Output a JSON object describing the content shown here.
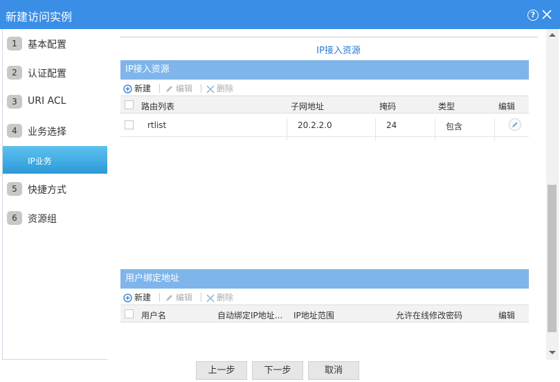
{
  "dialog": {
    "title": "新建访问实例",
    "help_glyph": "?"
  },
  "sidebar": {
    "steps": [
      {
        "num": "1",
        "label": "基本配置"
      },
      {
        "num": "2",
        "label": "认证配置"
      },
      {
        "num": "3",
        "label": "URI ACL"
      },
      {
        "num": "4",
        "label": "业务选择"
      },
      {
        "num": "5",
        "label": "快捷方式"
      },
      {
        "num": "6",
        "label": "资源组"
      }
    ],
    "active_sub": "IP业务"
  },
  "section": {
    "title": "IP接入资源"
  },
  "ip_panel": {
    "title": "IP接入资源",
    "toolbar": {
      "new": "新建",
      "edit": "编辑",
      "delete": "删除"
    },
    "columns": [
      "路由列表",
      "子网地址",
      "掩码",
      "类型",
      "编辑"
    ],
    "rows": [
      {
        "route": "rtlist",
        "subnet": "20.2.2.0",
        "mask": "24",
        "type": "包含"
      }
    ]
  },
  "user_panel": {
    "title": "用户绑定地址",
    "toolbar": {
      "new": "新建",
      "edit": "编辑",
      "delete": "删除"
    },
    "columns": [
      "用户名",
      "自动绑定IP地址...",
      "IP地址范围",
      "允许在线修改密码",
      "编辑"
    ]
  },
  "footer": {
    "prev": "上一步",
    "next": "下一步",
    "cancel": "取消"
  },
  "colors": {
    "titlebar": "#3a8ee6",
    "panel_header": "#7fb5ea",
    "accent_text": "#2b7bd4",
    "active_step": "#2b9ad8"
  },
  "icons": [
    "help-icon",
    "close-icon",
    "add-icon",
    "pencil-icon",
    "delete-x-icon",
    "edit-row-icon"
  ]
}
